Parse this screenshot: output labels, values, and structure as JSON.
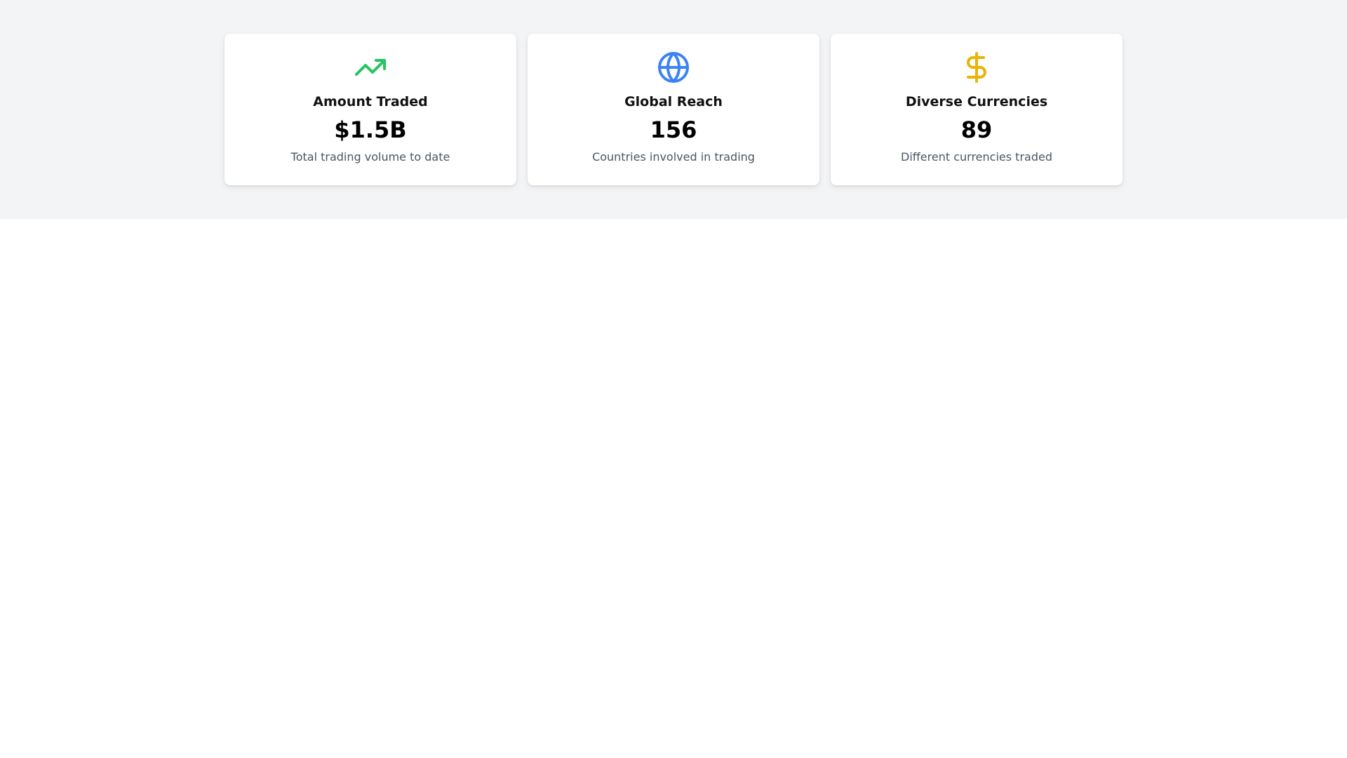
{
  "stats": [
    {
      "icon": "trending-up-icon",
      "color": "#22c55e",
      "title": "Amount Traded",
      "value": "$1.5B",
      "description": "Total trading volume to date"
    },
    {
      "icon": "globe-icon",
      "color": "#3b82f6",
      "title": "Global Reach",
      "value": "156",
      "description": "Countries involved in trading"
    },
    {
      "icon": "dollar-sign-icon",
      "color": "#eab308",
      "title": "Diverse Currencies",
      "value": "89",
      "description": "Different currencies traded"
    }
  ]
}
